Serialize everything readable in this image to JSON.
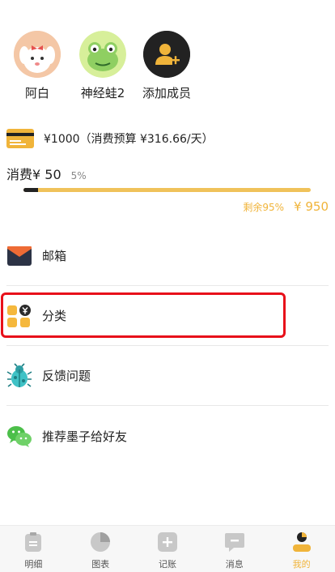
{
  "members": [
    {
      "name": "阿白",
      "icon": "puppy-avatar"
    },
    {
      "name": "神经蛙2",
      "icon": "frog-avatar"
    },
    {
      "name": "添加成员",
      "icon": "add-member-icon"
    }
  ],
  "budget": {
    "icon": "credit-card-icon",
    "text": "¥1000（消费预算 ¥316.66/天）",
    "spent_label": "消费¥ 50",
    "spent_percent_label": "5%",
    "spent_fraction": 0.05,
    "remaining_label": "剩余95%",
    "remaining_value": "¥ 950"
  },
  "menu": [
    {
      "label": "邮箱",
      "icon": "mailbox-icon"
    },
    {
      "label": "分类",
      "icon": "category-icon"
    },
    {
      "label": "反馈问题",
      "icon": "bug-icon"
    },
    {
      "label": "推荐墨子给好友",
      "icon": "wechat-icon"
    }
  ],
  "tabs": [
    {
      "label": "明细",
      "icon": "details-icon"
    },
    {
      "label": "图表",
      "icon": "chart-icon"
    },
    {
      "label": "记账",
      "icon": "add-record-icon"
    },
    {
      "label": "消息",
      "icon": "message-icon"
    },
    {
      "label": "我的",
      "icon": "profile-icon",
      "active": true
    }
  ],
  "colors": {
    "accent": "#f0b43a",
    "highlight": "#e8101a"
  }
}
